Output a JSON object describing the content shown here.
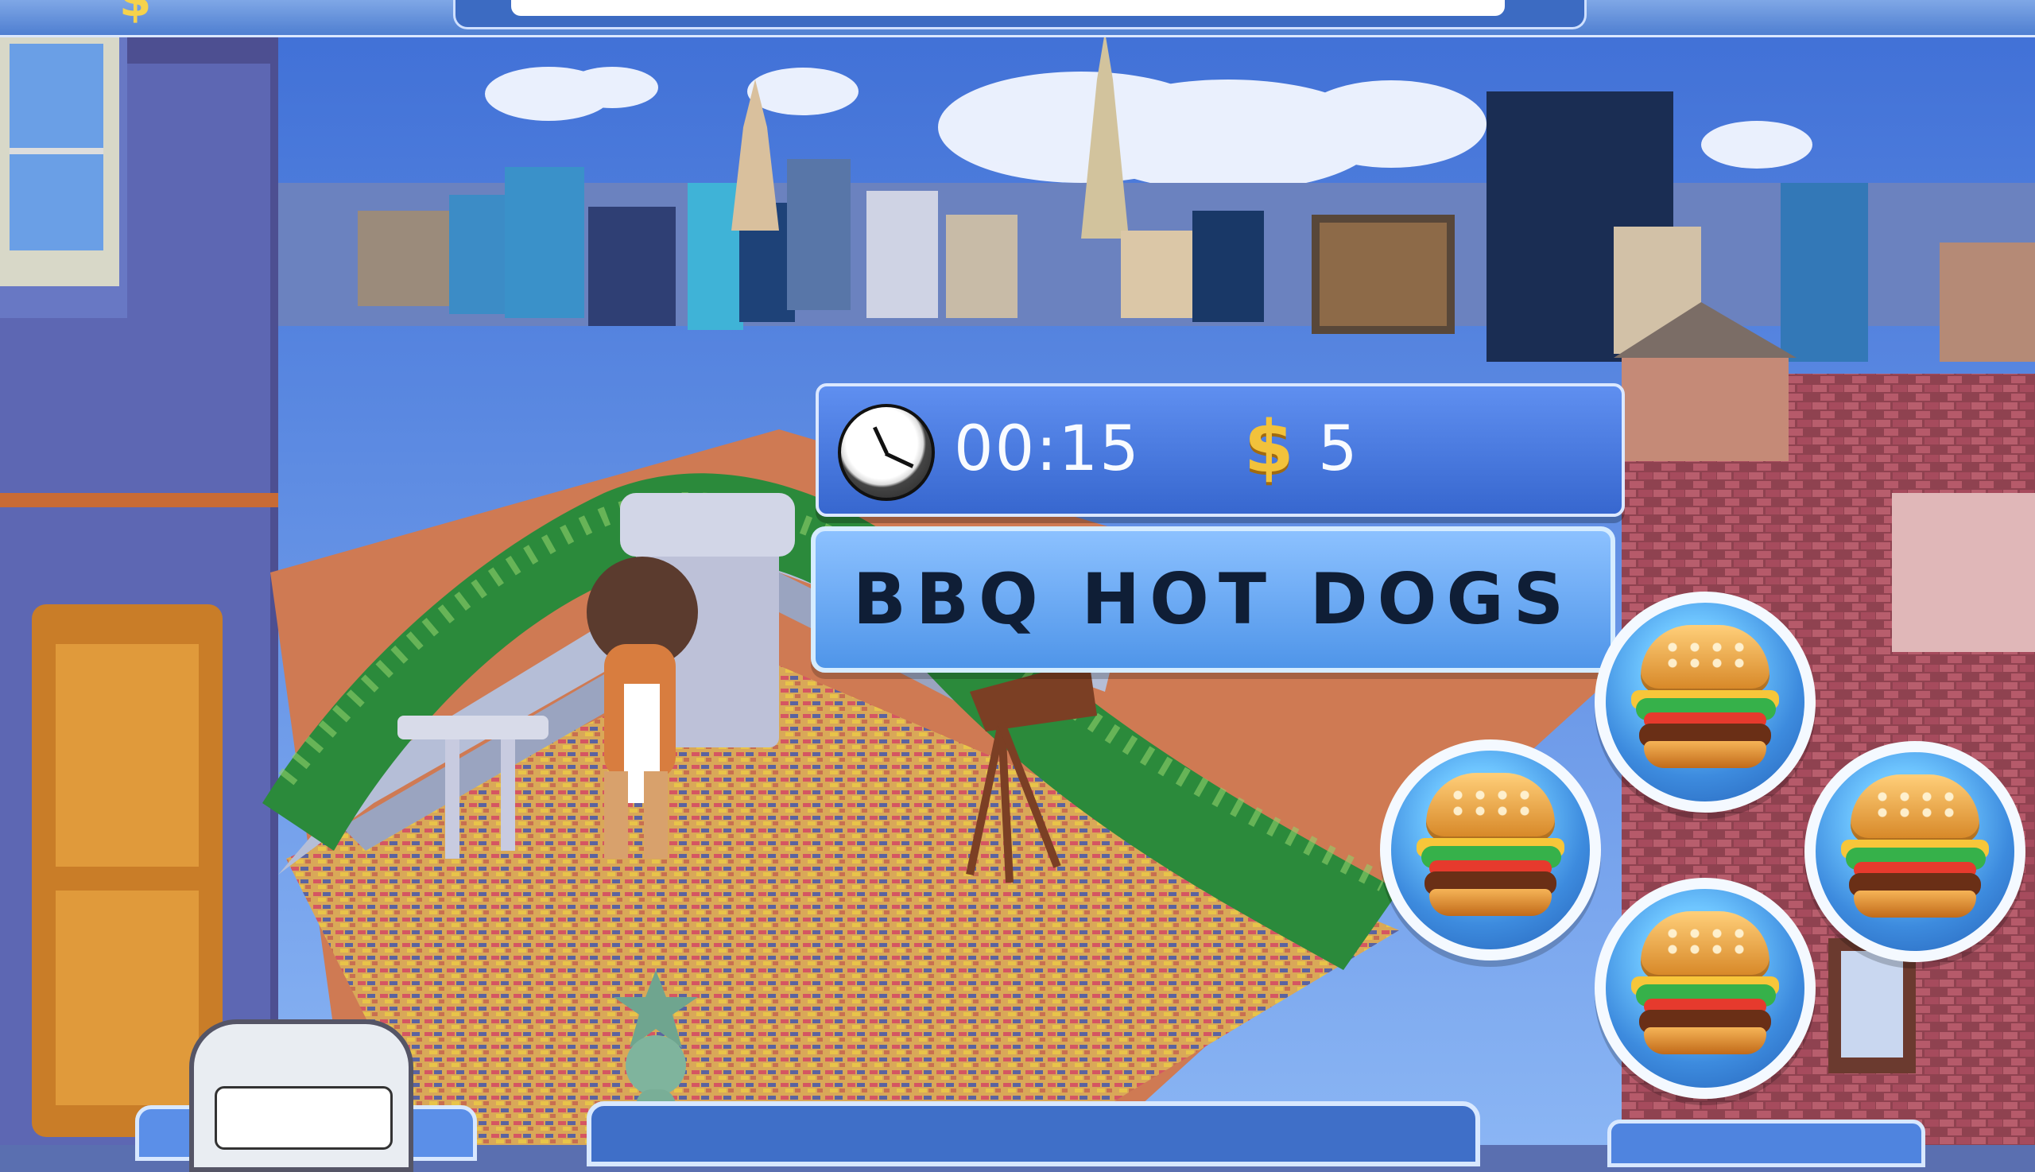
{
  "top_bar": {
    "money": "$",
    "time": ""
  },
  "hud": {
    "time": "00:15",
    "currency_symbol": "$",
    "money": "5"
  },
  "banner": {
    "title": "BBQ HOT DOGS"
  },
  "burgers": [
    {
      "id": "top"
    },
    {
      "id": "left"
    },
    {
      "id": "right"
    },
    {
      "id": "bottom"
    }
  ]
}
